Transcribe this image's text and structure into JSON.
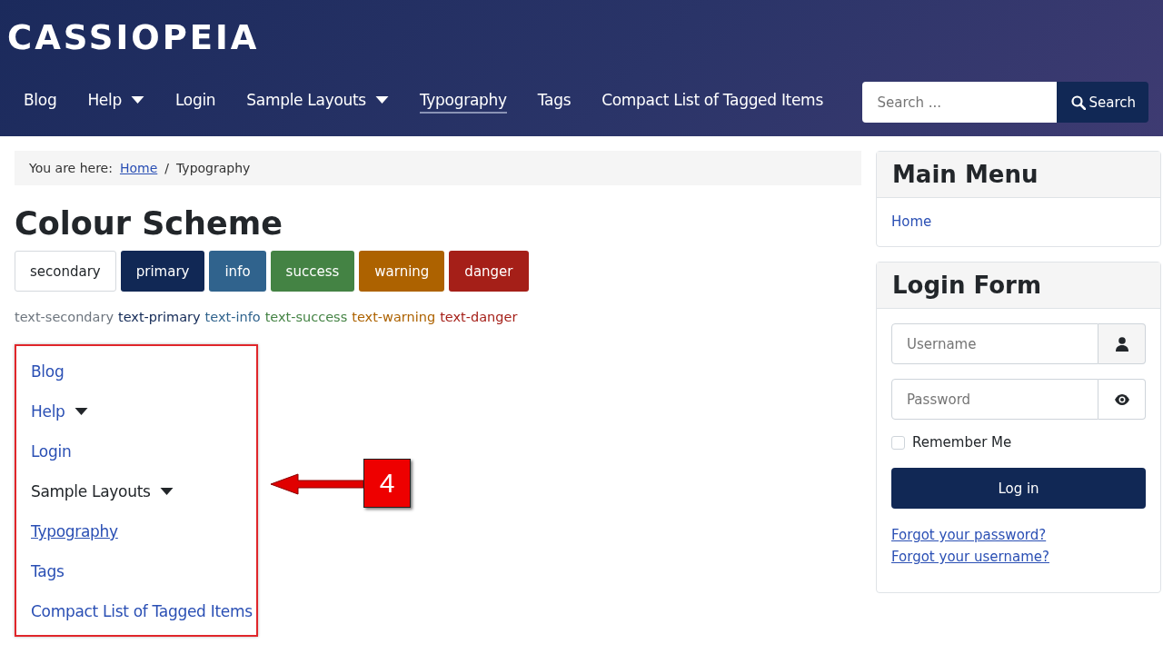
{
  "header": {
    "logo": "CASSIOPEIA",
    "nav": [
      {
        "label": "Blog",
        "selected": false,
        "dropdown": false
      },
      {
        "label": "Help",
        "selected": false,
        "dropdown": true
      },
      {
        "label": "Login",
        "selected": false,
        "dropdown": false
      },
      {
        "label": "Sample Layouts",
        "selected": false,
        "dropdown": true
      },
      {
        "label": "Typography",
        "selected": true,
        "dropdown": false
      },
      {
        "label": "Tags",
        "selected": false,
        "dropdown": false
      },
      {
        "label": "Compact List of Tagged Items",
        "selected": false,
        "dropdown": false
      }
    ],
    "search": {
      "placeholder": "Search ...",
      "button": "Search"
    }
  },
  "breadcrumb": {
    "prefix": "You are here:",
    "items": [
      {
        "label": "Home",
        "kind": "link"
      },
      {
        "label": "/",
        "kind": "separator"
      },
      {
        "label": "Typography",
        "kind": "current"
      }
    ]
  },
  "title": "Colour Scheme",
  "buttons": [
    {
      "label": "secondary",
      "color": "#ffffff"
    },
    {
      "label": "primary",
      "color": "#112855"
    },
    {
      "label": "info",
      "color": "#30638d"
    },
    {
      "label": "success",
      "color": "#448344"
    },
    {
      "label": "warning",
      "color": "#ad6200"
    },
    {
      "label": "danger",
      "color": "#a51f18"
    }
  ],
  "text_colors": [
    {
      "label": "text-secondary",
      "color": "#6d757e"
    },
    {
      "label": "text-primary",
      "color": "#112855"
    },
    {
      "label": "text-info",
      "color": "#30638d"
    },
    {
      "label": "text-success",
      "color": "#448344"
    },
    {
      "label": "text-warning",
      "color": "#ad6200"
    },
    {
      "label": "text-danger",
      "color": "#a51f18"
    }
  ],
  "menu": [
    {
      "label": "Blog",
      "kind": "link",
      "selected": false,
      "dropdown": false
    },
    {
      "label": "Help",
      "kind": "link",
      "selected": false,
      "dropdown": true
    },
    {
      "label": "Login",
      "kind": "link",
      "selected": false,
      "dropdown": false
    },
    {
      "label": "Sample Layouts",
      "kind": "heading",
      "selected": false,
      "dropdown": true
    },
    {
      "label": "Typography",
      "kind": "link",
      "selected": true,
      "dropdown": false
    },
    {
      "label": "Tags",
      "kind": "link",
      "selected": false,
      "dropdown": false
    },
    {
      "label": "Compact List of Tagged Items",
      "kind": "link",
      "selected": false,
      "dropdown": false
    }
  ],
  "callout": {
    "number": "4"
  },
  "sidebar": {
    "main_menu": {
      "title": "Main Menu",
      "items": [
        "Home"
      ]
    },
    "login": {
      "title": "Login Form",
      "username_placeholder": "Username",
      "password_placeholder": "Password",
      "remember": {
        "label": "Remember Me",
        "checked": false
      },
      "submit": "Log in",
      "links": [
        "Forgot your password?",
        "Forgot your username?"
      ]
    }
  }
}
